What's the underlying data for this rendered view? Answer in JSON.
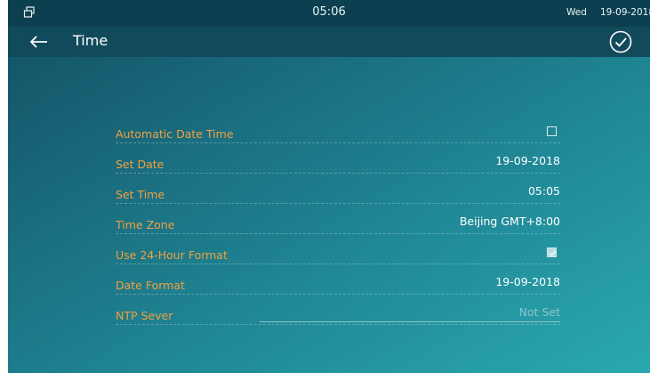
{
  "statusbar": {
    "window_icon": "window-restore-icon",
    "time": "05:06",
    "day": "Wed",
    "date": "19-09-2018"
  },
  "titlebar": {
    "back_icon": "arrow-left-icon",
    "title": "Time",
    "confirm_icon": "check-circle-icon"
  },
  "settings": [
    {
      "label": "Automatic Date Time",
      "type": "checkbox",
      "checked": false
    },
    {
      "label": "Set Date",
      "type": "value",
      "value": "19-09-2018"
    },
    {
      "label": "Set Time",
      "type": "value",
      "value": "05:05"
    },
    {
      "label": "Time Zone",
      "type": "value",
      "value": "Beijing GMT+8:00"
    },
    {
      "label": "Use 24-Hour Format",
      "type": "checkbox",
      "checked": true
    },
    {
      "label": "Date Format",
      "type": "value",
      "value": "19-09-2018"
    },
    {
      "label": "NTP Sever",
      "type": "input",
      "placeholder": "Not Set"
    }
  ],
  "colors": {
    "label": "#f0a042",
    "value": "#ffffff",
    "header": "#114a5b",
    "statusbar": "#0c3f4f"
  }
}
